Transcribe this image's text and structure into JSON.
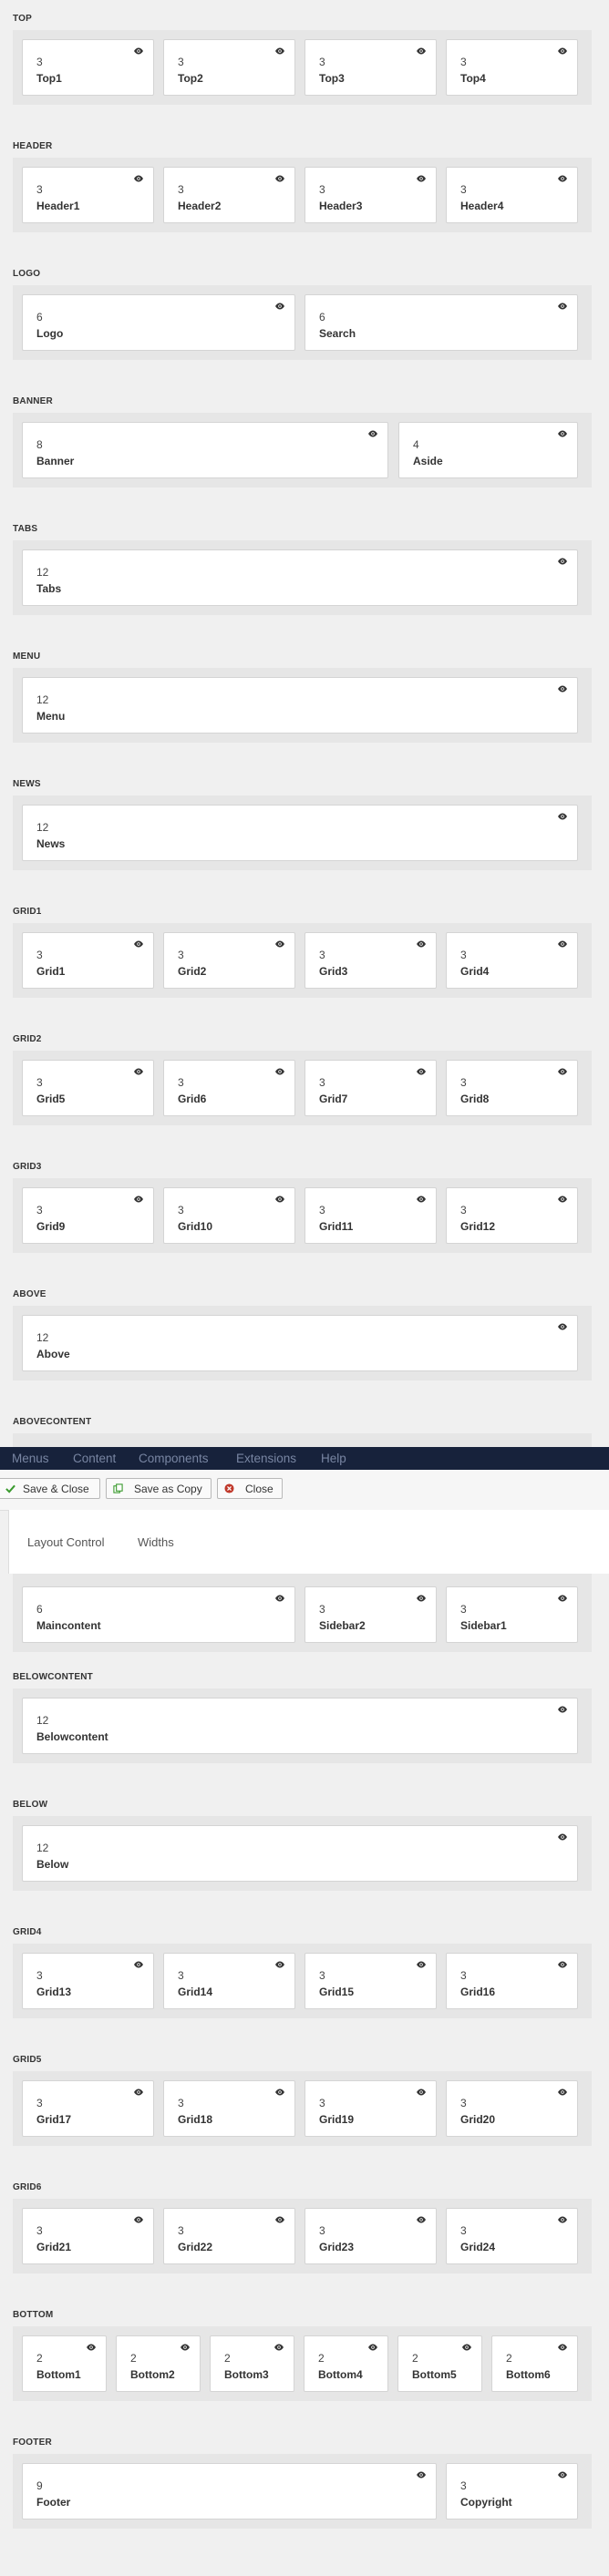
{
  "sections": {
    "top": {
      "title": "TOP",
      "cards": [
        {
          "num": "3",
          "name": "Top1"
        },
        {
          "num": "3",
          "name": "Top2"
        },
        {
          "num": "3",
          "name": "Top3"
        },
        {
          "num": "3",
          "name": "Top4"
        }
      ]
    },
    "header": {
      "title": "HEADER",
      "cards": [
        {
          "num": "3",
          "name": "Header1"
        },
        {
          "num": "3",
          "name": "Header2"
        },
        {
          "num": "3",
          "name": "Header3"
        },
        {
          "num": "3",
          "name": "Header4"
        }
      ]
    },
    "logo": {
      "title": "LOGO",
      "cards": [
        {
          "num": "6",
          "name": "Logo"
        },
        {
          "num": "6",
          "name": "Search"
        }
      ]
    },
    "banner": {
      "title": "BANNER",
      "cards": [
        {
          "num": "8",
          "name": "Banner"
        },
        {
          "num": "4",
          "name": "Aside"
        }
      ]
    },
    "tabs": {
      "title": "TABS",
      "cards": [
        {
          "num": "12",
          "name": "Tabs"
        }
      ]
    },
    "menu": {
      "title": "MENU",
      "cards": [
        {
          "num": "12",
          "name": "Menu"
        }
      ]
    },
    "news": {
      "title": "NEWS",
      "cards": [
        {
          "num": "12",
          "name": "News"
        }
      ]
    },
    "grid1": {
      "title": "GRID1",
      "cards": [
        {
          "num": "3",
          "name": "Grid1"
        },
        {
          "num": "3",
          "name": "Grid2"
        },
        {
          "num": "3",
          "name": "Grid3"
        },
        {
          "num": "3",
          "name": "Grid4"
        }
      ]
    },
    "grid2": {
      "title": "GRID2",
      "cards": [
        {
          "num": "3",
          "name": "Grid5"
        },
        {
          "num": "3",
          "name": "Grid6"
        },
        {
          "num": "3",
          "name": "Grid7"
        },
        {
          "num": "3",
          "name": "Grid8"
        }
      ]
    },
    "grid3": {
      "title": "GRID3",
      "cards": [
        {
          "num": "3",
          "name": "Grid9"
        },
        {
          "num": "3",
          "name": "Grid10"
        },
        {
          "num": "3",
          "name": "Grid11"
        },
        {
          "num": "3",
          "name": "Grid12"
        }
      ]
    },
    "above": {
      "title": "ABOVE",
      "cards": [
        {
          "num": "12",
          "name": "Above"
        }
      ]
    },
    "abovecontent": {
      "title": "ABOVECONTENT",
      "cards": []
    },
    "content": {
      "cards": [
        {
          "num": "6",
          "name": "Maincontent"
        },
        {
          "num": "3",
          "name": "Sidebar2"
        },
        {
          "num": "3",
          "name": "Sidebar1"
        }
      ]
    },
    "belowcontent": {
      "title": "BELOWCONTENT",
      "cards": [
        {
          "num": "12",
          "name": "Belowcontent"
        }
      ]
    },
    "below": {
      "title": "BELOW",
      "cards": [
        {
          "num": "12",
          "name": "Below"
        }
      ]
    },
    "grid4": {
      "title": "GRID4",
      "cards": [
        {
          "num": "3",
          "name": "Grid13"
        },
        {
          "num": "3",
          "name": "Grid14"
        },
        {
          "num": "3",
          "name": "Grid15"
        },
        {
          "num": "3",
          "name": "Grid16"
        }
      ]
    },
    "grid5": {
      "title": "GRID5",
      "cards": [
        {
          "num": "3",
          "name": "Grid17"
        },
        {
          "num": "3",
          "name": "Grid18"
        },
        {
          "num": "3",
          "name": "Grid19"
        },
        {
          "num": "3",
          "name": "Grid20"
        }
      ]
    },
    "grid6": {
      "title": "GRID6",
      "cards": [
        {
          "num": "3",
          "name": "Grid21"
        },
        {
          "num": "3",
          "name": "Grid22"
        },
        {
          "num": "3",
          "name": "Grid23"
        },
        {
          "num": "3",
          "name": "Grid24"
        }
      ]
    },
    "bottom": {
      "title": "BOTTOM",
      "cards": [
        {
          "num": "2",
          "name": "Bottom1"
        },
        {
          "num": "2",
          "name": "Bottom2"
        },
        {
          "num": "2",
          "name": "Bottom3"
        },
        {
          "num": "2",
          "name": "Bottom4"
        },
        {
          "num": "2",
          "name": "Bottom5"
        },
        {
          "num": "2",
          "name": "Bottom6"
        }
      ]
    },
    "footer": {
      "title": "FOOTER",
      "cards": [
        {
          "num": "9",
          "name": "Footer"
        },
        {
          "num": "3",
          "name": "Copyright"
        }
      ]
    }
  },
  "navbar": {
    "items": [
      "Menus",
      "Content",
      "Components",
      "Extensions",
      "Help"
    ]
  },
  "toolbar": {
    "save_close": "Save & Close",
    "save_copy": "Save as Copy",
    "close": "Close"
  },
  "tabs": {
    "layout_control": "Layout Control",
    "widths": "Widths"
  },
  "icons": {
    "eye": "eye-icon",
    "check": "check-icon",
    "copy": "copy-icon",
    "close": "close-circle-icon"
  },
  "colors": {
    "navbar_bg": "#17223b",
    "navbar_text": "#7885a2",
    "save_green": "#3a9a2e",
    "close_red": "#c0392b"
  }
}
